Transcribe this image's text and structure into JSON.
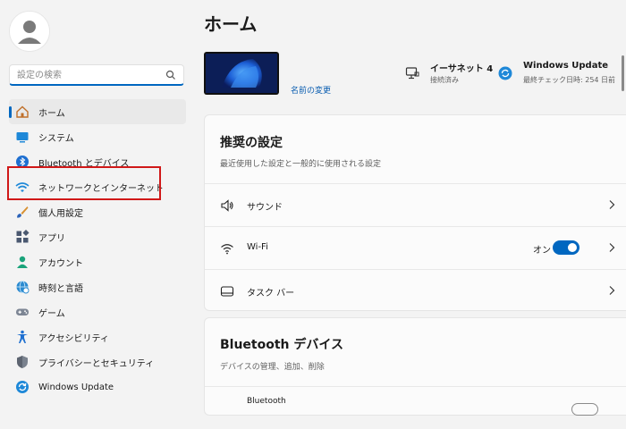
{
  "sidebar": {
    "search": {
      "placeholder": "設定の検索"
    },
    "items": [
      {
        "label": "ホーム",
        "icon": "home-icon",
        "active": true
      },
      {
        "label": "システム",
        "icon": "system-icon"
      },
      {
        "label": "Bluetooth とデバイス",
        "icon": "bluetooth-icon"
      },
      {
        "label": "ネットワークとインターネット",
        "icon": "wifi-icon"
      },
      {
        "label": "個人用設定",
        "icon": "brush-icon"
      },
      {
        "label": "アプリ",
        "icon": "apps-icon"
      },
      {
        "label": "アカウント",
        "icon": "account-icon"
      },
      {
        "label": "時刻と言語",
        "icon": "globe-clock-icon"
      },
      {
        "label": "ゲーム",
        "icon": "gamepad-icon"
      },
      {
        "label": "アクセシビリティ",
        "icon": "accessibility-icon"
      },
      {
        "label": "プライバシーとセキュリティ",
        "icon": "shield-icon"
      },
      {
        "label": "Windows Update",
        "icon": "update-icon"
      }
    ]
  },
  "main": {
    "title": "ホーム",
    "device": {
      "rename_label": "名前の変更"
    },
    "status": [
      {
        "title": "イーサネット 4",
        "subtitle": "接続済み",
        "icon": "ethernet-icon"
      },
      {
        "title": "Windows Update",
        "subtitle": "最終チェック日時: 254 日前",
        "icon": "update-icon"
      }
    ],
    "recommended": {
      "title": "推奨の設定",
      "subtitle": "最近使用した設定と一般的に使用される設定",
      "rows": [
        {
          "label": "サウンド",
          "icon": "speaker-icon"
        },
        {
          "label": "Wi-Fi",
          "icon": "wifi-icon",
          "toggle_label": "オン",
          "toggle_on": true
        },
        {
          "label": "タスク バー",
          "icon": "taskbar-icon"
        }
      ]
    },
    "bluetooth": {
      "title": "Bluetooth デバイス",
      "subtitle": "デバイスの管理、追加、削除",
      "row_label": "Bluetooth"
    }
  },
  "colors": {
    "accent": "#0067c0",
    "highlight": "#d01818",
    "background": "#f3f3f3"
  }
}
